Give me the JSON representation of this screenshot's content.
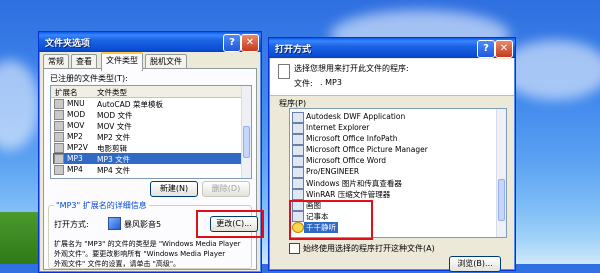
{
  "left_window": {
    "title": "文件夹选项",
    "tabs": [
      "常规",
      "查看",
      "文件类型",
      "脱机文件"
    ],
    "registered_label": "已注册的文件类型(T):",
    "columns": [
      "扩展名",
      "文件类型"
    ],
    "rows": [
      {
        "ext": "MNU",
        "type": "AutoCAD 菜单模板"
      },
      {
        "ext": "MOD",
        "type": "MOD 文件"
      },
      {
        "ext": "MOV",
        "type": "MOV 文件"
      },
      {
        "ext": "MP2",
        "type": "MP2 文件"
      },
      {
        "ext": "MP2V",
        "type": "电影剪辑"
      },
      {
        "ext": "MP3",
        "type": "MP3 文件"
      },
      {
        "ext": "MP4",
        "type": "MP4 文件"
      }
    ],
    "selected_ext": "MP3",
    "new_button": "新建(N)",
    "delete_button": "删除(D)",
    "details_label": "\"MP3\" 扩展名的详细信息",
    "opens_with_label": "打开方式:",
    "opens_with_app": "暴风影音5",
    "change_button": "更改(C)...",
    "desc_line1": "扩展名为 \"MP3\" 的文件的类型是 \"Windows Media Player",
    "desc_line2": "外观文件\"。要更改影响所有 \"Windows Media Player",
    "desc_line3": "外观文件\" 文件的设置，请单击 \"高级\"。"
  },
  "right_window": {
    "title": "打开方式",
    "prompt": "选择您想用来打开此文件的程序:",
    "file_label": "文件:",
    "file_name": ". MP3",
    "programs_label": "程序(P)",
    "programs": [
      "Autodesk DWF Application",
      "Internet Explorer",
      "Microsoft Office InfoPath",
      "Microsoft Office Picture Manager",
      "Microsoft Office Word",
      "Pro/ENGINEER",
      "Windows 图片和传真查看器",
      "WinRAR 压缩文件管理器",
      "画图",
      "记事本",
      "千千静听"
    ],
    "selected_program": "千千静听",
    "always_use_label": "始终使用选择的程序打开这种文件(A)",
    "browse_button": "浏览(B)..."
  }
}
